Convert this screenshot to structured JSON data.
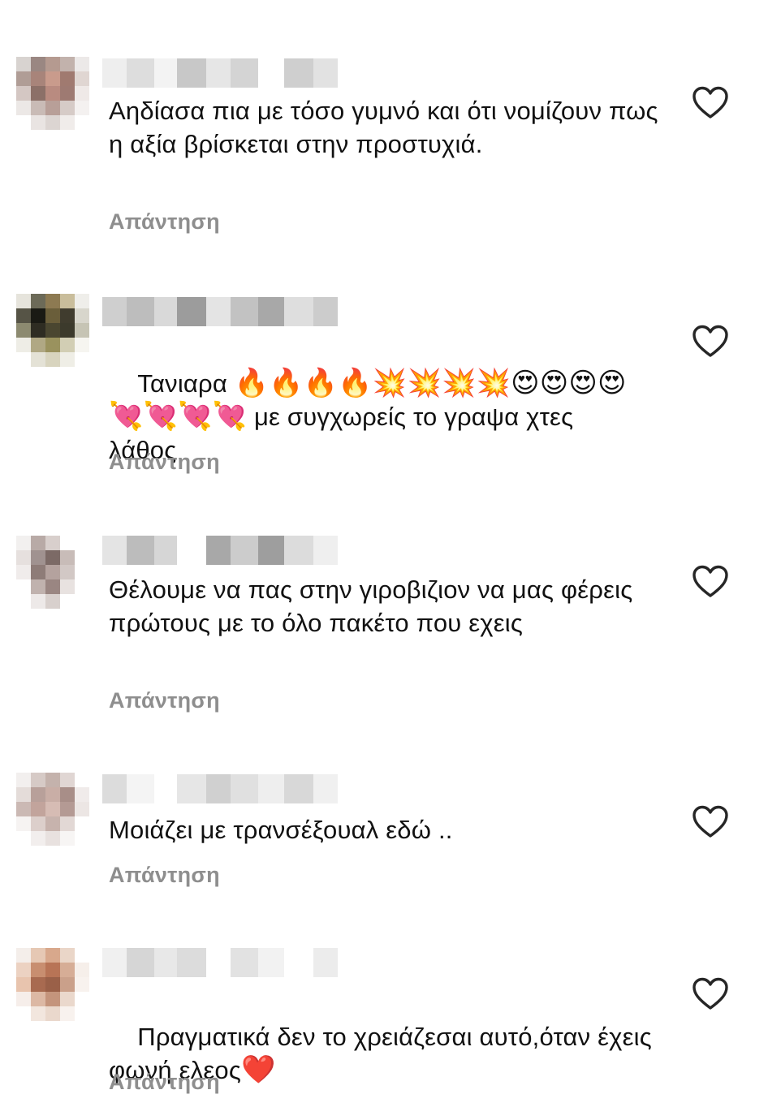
{
  "reply_label": "Απάντηση",
  "comments": [
    {
      "text": "Αηδίασα πια με τόσο γυμνό και ότι νομίζουν πως η αξία βρίσκεται στην προστυχιά.",
      "avatar": [
        "#d8d3d0",
        "#9a8782",
        "#b59a90",
        "#c2b2ac",
        "#ece9e8",
        "#b09d96",
        "#a8847a",
        "#c99b8c",
        "#a07a70",
        "#e0d6d2",
        "#d4c7c3",
        "#8c7068",
        "#b98b80",
        "#9e7a72",
        "#efe9e7",
        "#ece8e6",
        "#c9bbb6",
        "#b89f98",
        "#d6cbc7",
        "#f4f1f0",
        "#ffffff",
        "#e9e4e2",
        "#dcd5d2",
        "#f0ecea",
        "#ffffff"
      ],
      "username_blocks": [
        "#eeeeee",
        "#dddddd",
        "#f3f3f3",
        "#c8c8c8",
        "#e6e6e6",
        "#d4d4d4",
        "#ffffff",
        "#cfcfcf",
        "#e2e2e2"
      ]
    },
    {
      "text_parts": [
        "Ταniαρα"
      ],
      "text_prefix": "Ταniαρα ",
      "text_rest": "με συγχωρείς το γραψα χτες λάθος",
      "emoji_line": "🔥🔥🔥🔥💥💥💥💥😍😍😍😍💘💘💘💘",
      "avatar": [
        "#e6e4dc",
        "#6c6a58",
        "#8d7a52",
        "#c9bd9b",
        "#efeeea",
        "#565446",
        "#1a1a14",
        "#6a5e3a",
        "#403c2e",
        "#d8d6cc",
        "#8c8a70",
        "#2e2c22",
        "#4a4630",
        "#3c3a2c",
        "#c6c4b4",
        "#eeede6",
        "#b0a884",
        "#9a925e",
        "#d2ceb4",
        "#f6f5f0",
        "#ffffff",
        "#e4e2d6",
        "#d8d4be",
        "#efeee6",
        "#ffffff"
      ],
      "username_blocks": [
        "#cfcfcf",
        "#bdbdbd",
        "#d9d9d9",
        "#9c9c9c",
        "#e4e4e4",
        "#c2c2c2",
        "#a8a8a8",
        "#dedede",
        "#cccccc"
      ]
    },
    {
      "text": "Θέλουμε να πας στην γιροβιζιον να μας φέρεις πρώτους με το όλο πακέτο που εχεις",
      "avatar": [
        "#f2f0ef",
        "#b8aaa6",
        "#d8cfcc",
        "#ffffff",
        "#ffffff",
        "#e6e0de",
        "#a09290",
        "#7c6a66",
        "#c8bcb8",
        "#ffffff",
        "#f0eceb",
        "#8e7c78",
        "#b4a29e",
        "#d2c8c5",
        "#ffffff",
        "#ffffff",
        "#c0b2ae",
        "#9a8682",
        "#e8e2e0",
        "#ffffff",
        "#ffffff",
        "#ede9e8",
        "#d8d0cd",
        "#ffffff",
        "#ffffff"
      ],
      "username_blocks": [
        "#e4e4e4",
        "#bcbcbc",
        "#d6d6d6",
        "#ffffff",
        "#a8a8a8",
        "#cccccc",
        "#9e9e9e",
        "#dcdcdc",
        "#efefef"
      ]
    },
    {
      "text": "Μοιάζει με τρανσέξουαλ εδώ ..",
      "avatar": [
        "#f2efee",
        "#d6cac6",
        "#c4b2ac",
        "#e0d6d3",
        "#ffffff",
        "#e4dcd9",
        "#b8a09a",
        "#c9aea6",
        "#a88e88",
        "#f0ebea",
        "#cbb9b4",
        "#c2a49c",
        "#d6bcb4",
        "#b49a94",
        "#ece6e4",
        "#f6f3f2",
        "#dccfcb",
        "#c7b3ad",
        "#e2d8d5",
        "#ffffff",
        "#ffffff",
        "#f2eeed",
        "#e8e1df",
        "#f7f5f4",
        "#ffffff"
      ],
      "username_blocks": [
        "#dcdcdc",
        "#f4f4f4",
        "#ffffff",
        "#e6e6e6",
        "#d0d0d0",
        "#e0e0e0",
        "#eeeeee",
        "#d8d8d8",
        "#f0f0f0"
      ]
    },
    {
      "text": "Πραγματικά δεν το χρειάζεσαι αυτό,όταν έχεις φωνή ελεος",
      "text_suffix_emoji": "❤️",
      "avatar": [
        "#f4eeea",
        "#e6c8b4",
        "#d8a88c",
        "#ead6c8",
        "#ffffff",
        "#ecd2c2",
        "#c88e70",
        "#b87456",
        "#d6ad96",
        "#f6efea",
        "#e8c4ae",
        "#a86a50",
        "#9a6048",
        "#caa08a",
        "#f8f2ee",
        "#f6eeea",
        "#dcb8a4",
        "#c4947c",
        "#ead8cc",
        "#ffffff",
        "#ffffff",
        "#f2e6de",
        "#ead8cc",
        "#f8f2ee",
        "#ffffff"
      ],
      "username_blocks": [
        "#f0f0f0",
        "#d6d6d6",
        "#e8e8e8",
        "#dcdcdc",
        "#ffffff",
        "#e2e2e2",
        "#f2f2f2",
        "#ffffff",
        "#ececec"
      ]
    }
  ]
}
